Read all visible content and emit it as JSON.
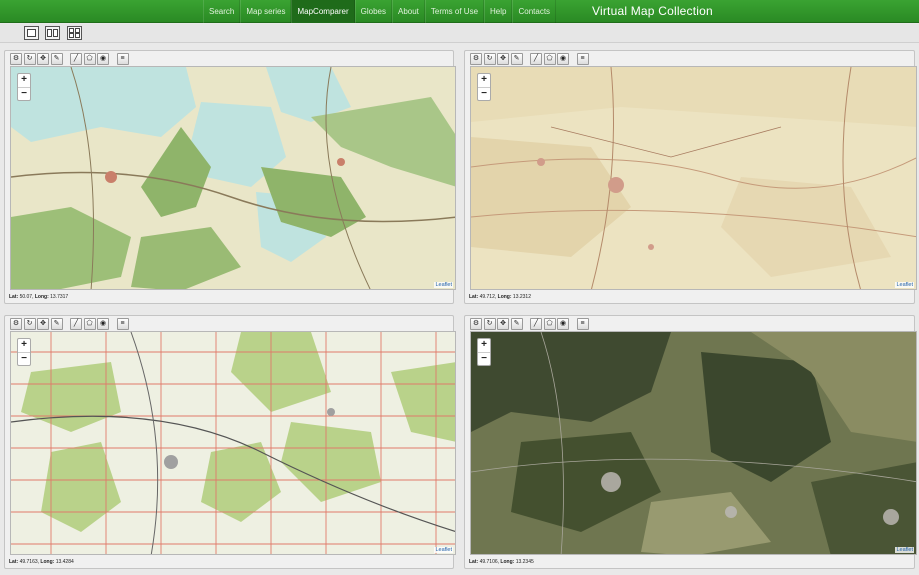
{
  "nav": {
    "items": [
      {
        "label": "Search",
        "active": false
      },
      {
        "label": "Map series",
        "active": false
      },
      {
        "label": "MapComparer",
        "active": true
      },
      {
        "label": "Globes",
        "active": false
      },
      {
        "label": "About",
        "active": false
      },
      {
        "label": "Terms of Use",
        "active": false
      },
      {
        "label": "Help",
        "active": false
      },
      {
        "label": "Contacts",
        "active": false
      }
    ],
    "brand": "Virtual Map Collection"
  },
  "layout_options": [
    "single-view-icon",
    "two-column-view-icon",
    "four-grid-view-icon"
  ],
  "tool_icons": [
    "settings-icon",
    "refresh-icon",
    "move-icon",
    "edit-icon",
    "line-icon",
    "polygon-icon",
    "target-icon",
    "list-icon"
  ],
  "zoom": {
    "in": "+",
    "out": "−"
  },
  "panels": [
    {
      "style": "old-color-survey",
      "lat_label": "Lat:",
      "lat": "50.07",
      "long_label": "Long:",
      "long": "13.7317",
      "attribution": "Leaflet"
    },
    {
      "style": "cadastral-tan",
      "lat_label": "Lat:",
      "lat": "49.712",
      "long_label": "Long:",
      "long": "13.2312",
      "attribution": "Leaflet"
    },
    {
      "style": "topo-grid",
      "lat_label": "Lat:",
      "lat": "49.7163",
      "long_label": "Long:",
      "long": "13.4284",
      "attribution": "Leaflet"
    },
    {
      "style": "satellite",
      "lat_label": "Lat:",
      "lat": "49.7106",
      "long_label": "Long:",
      "long": "13.2345",
      "attribution": "Leaflet"
    }
  ],
  "colors": {
    "nav_green": "#2f9a29",
    "nav_active": "#1f6b1a",
    "water": "#bfe3df",
    "forest": "#8fb46a",
    "paper": "#ece3c1"
  }
}
